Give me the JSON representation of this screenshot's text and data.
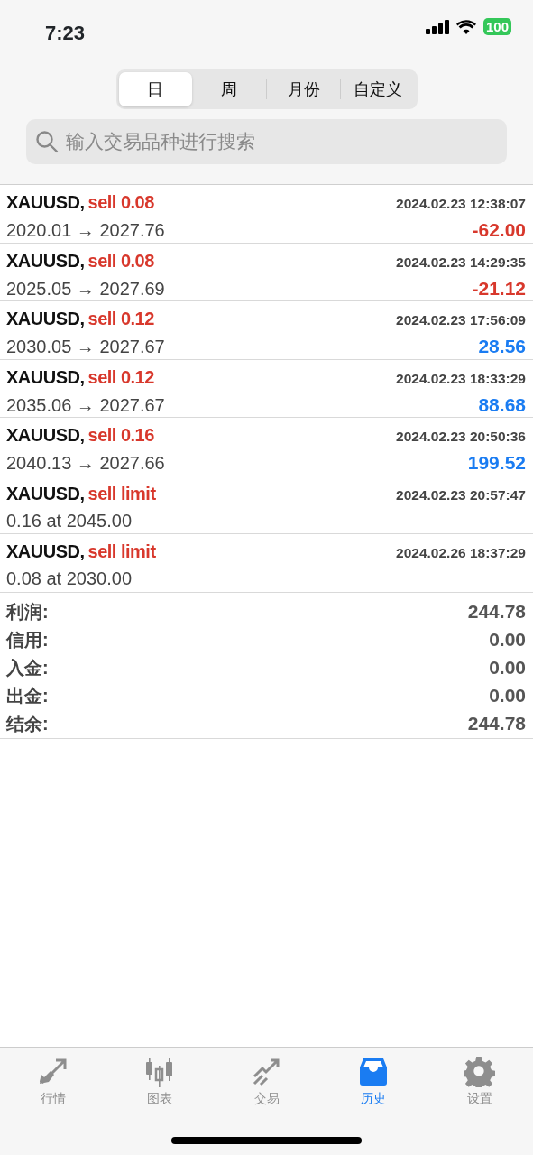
{
  "status_bar": {
    "time": "7:23",
    "battery": "100"
  },
  "period_tabs": [
    {
      "label": "日",
      "selected": true
    },
    {
      "label": "周",
      "selected": false
    },
    {
      "label": "月份",
      "selected": false
    },
    {
      "label": "自定义",
      "selected": false
    }
  ],
  "search": {
    "placeholder": "输入交易品种进行搜索"
  },
  "orders": [
    {
      "symbol": "XAUUSD,",
      "type": "sell 0.08",
      "time": "2024.02.23 12:38:07",
      "detail": "2020.01 → 2027.76",
      "profit": "-62.00",
      "color": "#d8382c"
    },
    {
      "symbol": "XAUUSD,",
      "type": "sell 0.08",
      "time": "2024.02.23 14:29:35",
      "detail": "2025.05 → 2027.69",
      "profit": "-21.12",
      "color": "#d8382c"
    },
    {
      "symbol": "XAUUSD,",
      "type": "sell 0.12",
      "time": "2024.02.23 17:56:09",
      "detail": "2030.05 → 2027.67",
      "profit": "28.56",
      "color": "#1a7cf2"
    },
    {
      "symbol": "XAUUSD,",
      "type": "sell 0.12",
      "time": "2024.02.23 18:33:29",
      "detail": "2035.06 → 2027.67",
      "profit": "88.68",
      "color": "#1a7cf2"
    },
    {
      "symbol": "XAUUSD,",
      "type": "sell 0.16",
      "time": "2024.02.23 20:50:36",
      "detail": "2040.13 → 2027.66",
      "profit": "199.52",
      "color": "#1a7cf2"
    },
    {
      "symbol": "XAUUSD,",
      "type": "sell limit",
      "time": "2024.02.23 20:57:47",
      "detail": "0.16 at 2045.00"
    },
    {
      "symbol": "XAUUSD,",
      "type": "sell limit",
      "time": "2024.02.26 18:37:29",
      "detail": "0.08 at 2030.00"
    }
  ],
  "summary": [
    {
      "label": "利润:",
      "value": "244.78"
    },
    {
      "label": "信用:",
      "value": "0.00"
    },
    {
      "label": "入金:",
      "value": "0.00"
    },
    {
      "label": "出金:",
      "value": "0.00"
    },
    {
      "label": "结余:",
      "value": "244.78"
    }
  ],
  "bottom_tabs": [
    {
      "label": "行情",
      "selected": false
    },
    {
      "label": "图表",
      "selected": false
    },
    {
      "label": "交易",
      "selected": false
    },
    {
      "label": "历史",
      "selected": true
    },
    {
      "label": "设置",
      "selected": false
    }
  ]
}
